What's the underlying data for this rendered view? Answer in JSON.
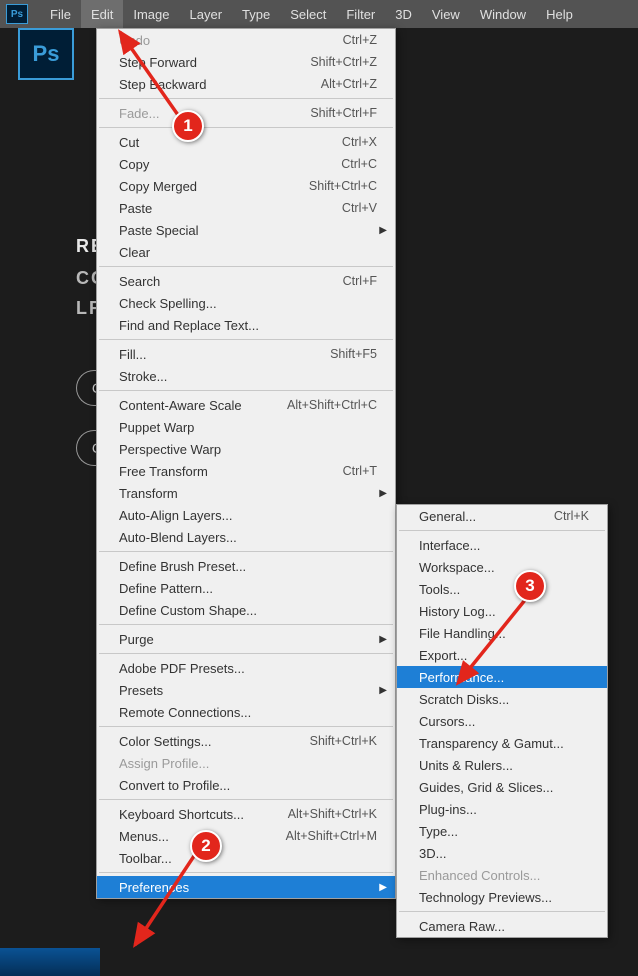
{
  "menubar": {
    "items": [
      "File",
      "Edit",
      "Image",
      "Layer",
      "Type",
      "Select",
      "Filter",
      "3D",
      "View",
      "Window",
      "Help"
    ],
    "active_index": 1
  },
  "app_icon": "Ps",
  "background": {
    "line1": "RE",
    "line2": "CC",
    "line3": "LR",
    "pill1": "C",
    "pill2": "C"
  },
  "edit_menu": {
    "groups": [
      [
        {
          "label": "Undo",
          "shortcut": "Ctrl+Z",
          "disabled": true
        },
        {
          "label": "Step Forward",
          "shortcut": "Shift+Ctrl+Z"
        },
        {
          "label": "Step Backward",
          "shortcut": "Alt+Ctrl+Z"
        }
      ],
      [
        {
          "label": "Fade...",
          "shortcut": "Shift+Ctrl+F",
          "disabled": true
        }
      ],
      [
        {
          "label": "Cut",
          "shortcut": "Ctrl+X"
        },
        {
          "label": "Copy",
          "shortcut": "Ctrl+C"
        },
        {
          "label": "Copy Merged",
          "shortcut": "Shift+Ctrl+C"
        },
        {
          "label": "Paste",
          "shortcut": "Ctrl+V"
        },
        {
          "label": "Paste Special",
          "submenu": true
        },
        {
          "label": "Clear"
        }
      ],
      [
        {
          "label": "Search",
          "shortcut": "Ctrl+F"
        },
        {
          "label": "Check Spelling..."
        },
        {
          "label": "Find and Replace Text..."
        }
      ],
      [
        {
          "label": "Fill...",
          "shortcut": "Shift+F5"
        },
        {
          "label": "Stroke..."
        }
      ],
      [
        {
          "label": "Content-Aware Scale",
          "shortcut": "Alt+Shift+Ctrl+C"
        },
        {
          "label": "Puppet Warp"
        },
        {
          "label": "Perspective Warp"
        },
        {
          "label": "Free Transform",
          "shortcut": "Ctrl+T"
        },
        {
          "label": "Transform",
          "submenu": true
        },
        {
          "label": "Auto-Align Layers..."
        },
        {
          "label": "Auto-Blend Layers..."
        }
      ],
      [
        {
          "label": "Define Brush Preset..."
        },
        {
          "label": "Define Pattern..."
        },
        {
          "label": "Define Custom Shape..."
        }
      ],
      [
        {
          "label": "Purge",
          "submenu": true
        }
      ],
      [
        {
          "label": "Adobe PDF Presets..."
        },
        {
          "label": "Presets",
          "submenu": true
        },
        {
          "label": "Remote Connections..."
        }
      ],
      [
        {
          "label": "Color Settings...",
          "shortcut": "Shift+Ctrl+K"
        },
        {
          "label": "Assign Profile...",
          "disabled": true
        },
        {
          "label": "Convert to Profile..."
        }
      ],
      [
        {
          "label": "Keyboard Shortcuts...",
          "shortcut": "Alt+Shift+Ctrl+K"
        },
        {
          "label": "Menus...",
          "shortcut": "Alt+Shift+Ctrl+M"
        },
        {
          "label": "Toolbar..."
        }
      ],
      [
        {
          "label": "Preferences",
          "submenu": true,
          "selected": true
        }
      ]
    ]
  },
  "pref_menu": {
    "groups": [
      [
        {
          "label": "General...",
          "shortcut": "Ctrl+K"
        }
      ],
      [
        {
          "label": "Interface..."
        },
        {
          "label": "Workspace..."
        },
        {
          "label": "Tools..."
        },
        {
          "label": "History Log..."
        },
        {
          "label": "File Handling..."
        },
        {
          "label": "Export..."
        },
        {
          "label": "Performance...",
          "selected": true
        },
        {
          "label": "Scratch Disks..."
        },
        {
          "label": "Cursors..."
        },
        {
          "label": "Transparency & Gamut..."
        },
        {
          "label": "Units & Rulers..."
        },
        {
          "label": "Guides, Grid & Slices..."
        },
        {
          "label": "Plug-ins..."
        },
        {
          "label": "Type..."
        },
        {
          "label": "3D..."
        },
        {
          "label": "Enhanced Controls...",
          "disabled": true
        },
        {
          "label": "Technology Previews..."
        }
      ],
      [
        {
          "label": "Camera Raw..."
        }
      ]
    ]
  },
  "callouts": {
    "c1": "1",
    "c2": "2",
    "c3": "3"
  }
}
